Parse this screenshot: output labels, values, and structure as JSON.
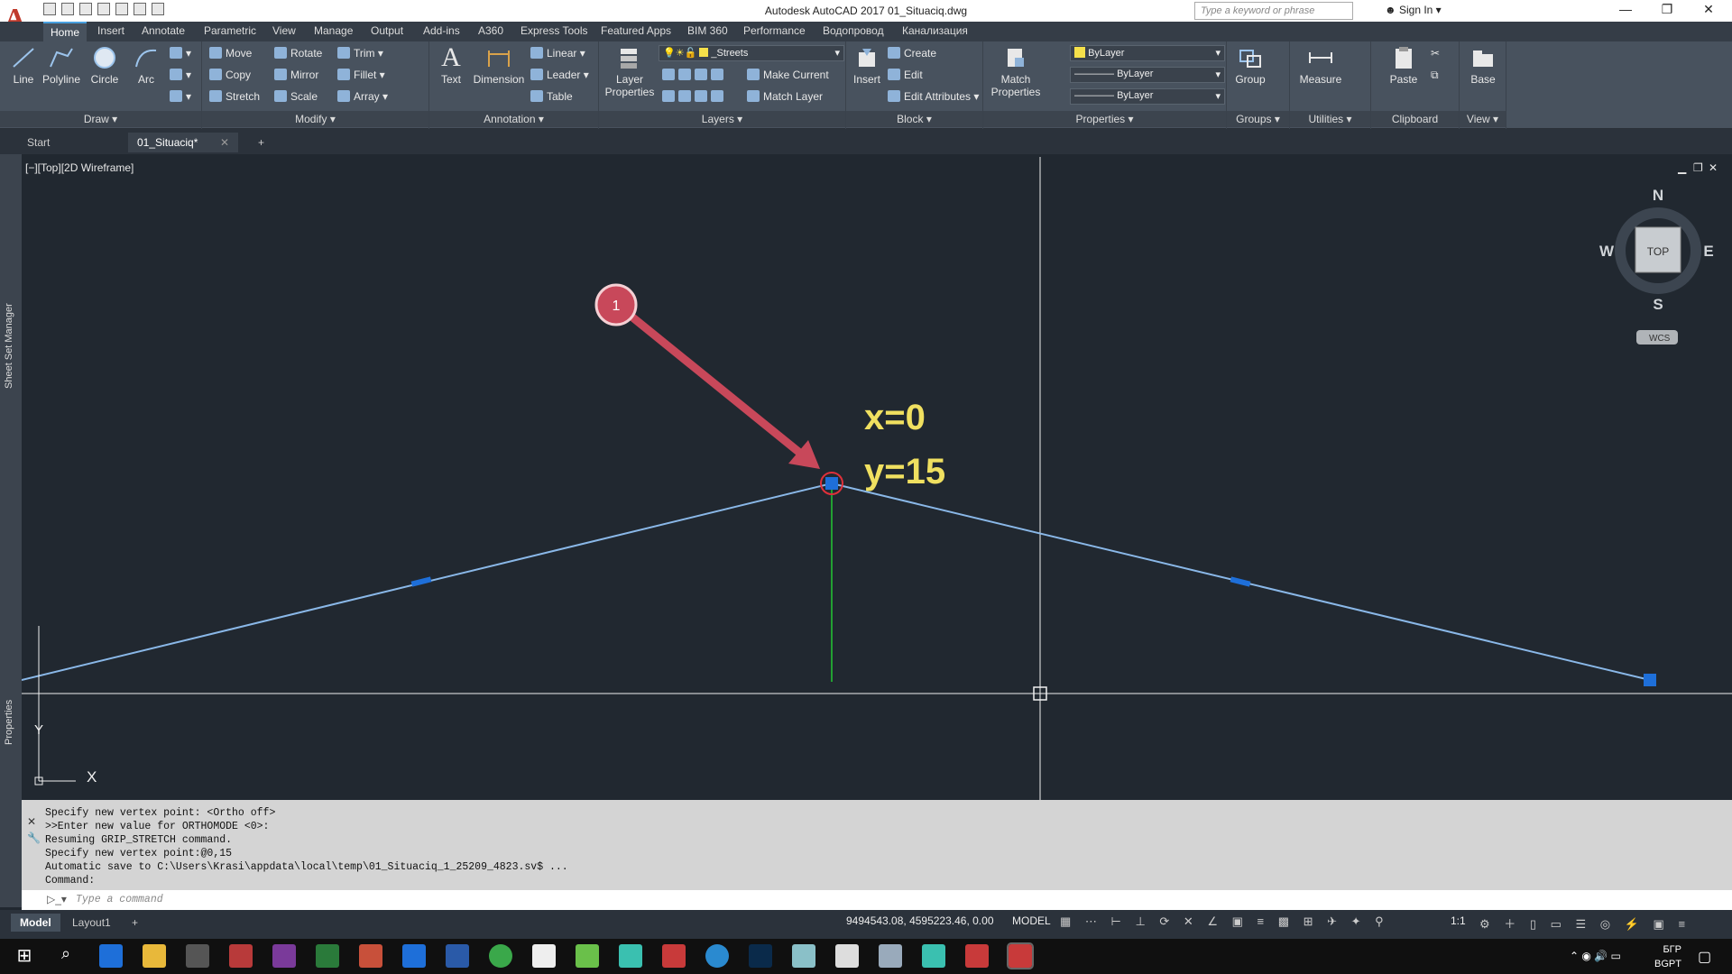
{
  "app": {
    "title": "Autodesk AutoCAD 2017    01_Situaciq.dwg",
    "search_placeholder": "Type a keyword or phrase",
    "sign_in": "Sign In"
  },
  "ribbon_tabs": [
    "Home",
    "Insert",
    "Annotate",
    "Parametric",
    "View",
    "Manage",
    "Output",
    "Add-ins",
    "A360",
    "Express Tools",
    "Featured Apps",
    "BIM 360",
    "Performance",
    "Водопровод",
    "Канализация"
  ],
  "draw": {
    "label": "Draw",
    "buttons": [
      "Line",
      "Polyline",
      "Circle",
      "Arc"
    ]
  },
  "modify": {
    "label": "Modify",
    "items": [
      "Move",
      "Rotate",
      "Trim",
      "Copy",
      "Mirror",
      "Fillet",
      "Stretch",
      "Scale",
      "Array"
    ]
  },
  "annotation": {
    "label": "Annotation",
    "buttons": [
      "Text",
      "Dimension"
    ],
    "items": [
      "Linear",
      "Leader",
      "Table"
    ]
  },
  "layers": {
    "label": "Layers",
    "button": "Layer Properties",
    "current_layer": "_Streets",
    "items": [
      "Make Current",
      "Match Layer"
    ]
  },
  "block": {
    "label": "Block",
    "button": "Insert",
    "items": [
      "Create",
      "Edit",
      "Edit Attributes"
    ]
  },
  "properties": {
    "label": "Properties",
    "button": "Match Properties",
    "color": "ByLayer",
    "linetype": "ByLayer",
    "lineweight": "ByLayer"
  },
  "groups": {
    "label": "Groups",
    "button": "Group"
  },
  "utilities": {
    "label": "Utilities",
    "button": "Measure"
  },
  "clipboard": {
    "label": "Clipboard",
    "button": "Paste"
  },
  "view_panel": {
    "label": "View",
    "button": "Base"
  },
  "doc_tabs": [
    "Start",
    "01_Situaciq*"
  ],
  "viewport": {
    "label": "[−][Top][2D Wireframe]"
  },
  "viewcube": {
    "n": "N",
    "s": "S",
    "e": "E",
    "w": "W",
    "face": "TOP",
    "wcs": "WCS"
  },
  "annotation_marks": {
    "step": "1",
    "x_label": "x=0",
    "y_label": "y=15"
  },
  "ucs": {
    "x": "X",
    "y": "Y"
  },
  "side_palettes": [
    "Sheet Set Manager",
    "Properties"
  ],
  "command_history": [
    "Specify new vertex point: <Ortho off>",
    ">>Enter new value for ORTHOMODE <0>:",
    "Resuming GRIP_STRETCH command.",
    "Specify new vertex point:@0,15",
    "Automatic save to C:\\Users\\Krasi\\appdata\\local\\temp\\01_Situaciq_1_25209_4823.sv$ ...",
    "Command:"
  ],
  "command_placeholder": "Type a command",
  "layout_tabs": [
    "Model",
    "Layout1"
  ],
  "status": {
    "coords": "9494543.08, 4595223.46, 0.00",
    "mode": "MODEL",
    "scale": "1:1"
  },
  "tray": {
    "lang": "БГР",
    "kbd": "BGPT"
  },
  "colors": {
    "accent": "#48a0e0",
    "polyline": "#8ab8e8",
    "grip": "#1e6fd9",
    "annotation_arrow": "#c8485a",
    "label": "#f0e060"
  }
}
